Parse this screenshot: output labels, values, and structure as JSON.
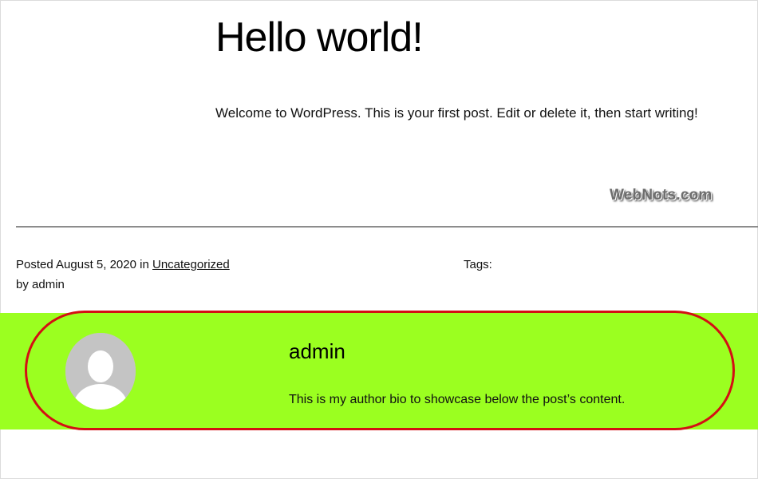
{
  "post": {
    "title": "Hello world!",
    "content": "Welcome to WordPress. This is your first post. Edit or delete it, then start writing!"
  },
  "watermark": {
    "text": "WebNots.com"
  },
  "meta": {
    "posted_prefix": "Posted",
    "date": "August 5, 2020",
    "in_word": "in",
    "category": "Uncategorized",
    "by_line": "by admin",
    "tags_label": "Tags:"
  },
  "author_box": {
    "name": "admin",
    "bio": "This is my author bio to showcase below the post’s content.",
    "background_color": "#9bff20",
    "highlight_color": "#d40f14",
    "avatar_icon": "default-avatar-icon"
  }
}
